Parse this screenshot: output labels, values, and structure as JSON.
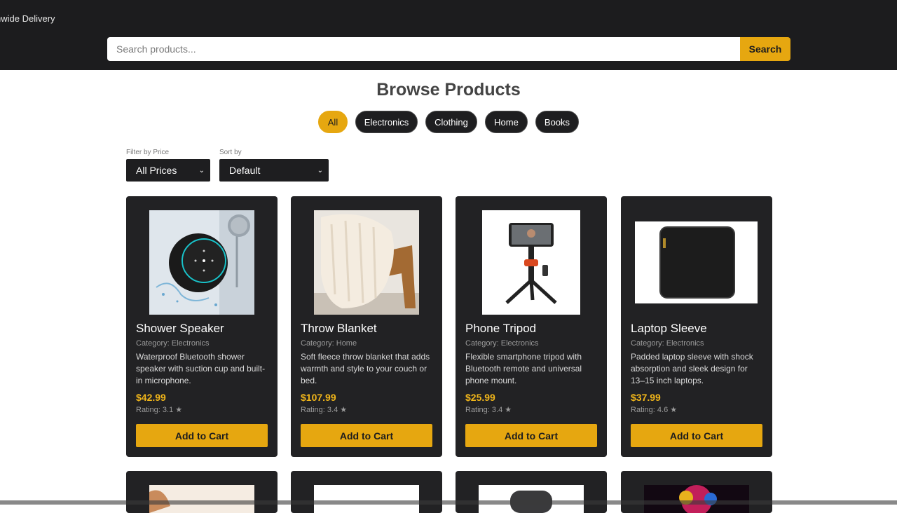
{
  "header": {
    "promo": "nwide Delivery",
    "search_placeholder": "Search products...",
    "search_label": "Search"
  },
  "page_title": "Browse Products",
  "categories": [
    "All",
    "Electronics",
    "Clothing",
    "Home",
    "Books"
  ],
  "filters": {
    "price_label": "Filter by Price",
    "price_value": "All Prices",
    "sort_label": "Sort by",
    "sort_value": "Default"
  },
  "products": [
    {
      "name": "Shower Speaker",
      "category": "Category: Electronics",
      "description": "Waterproof Bluetooth shower speaker with suction cup and built-in microphone.",
      "price": "$42.99",
      "rating": "Rating: 3.1 ★",
      "button": "Add to Cart"
    },
    {
      "name": "Throw Blanket",
      "category": "Category: Home",
      "description": "Soft fleece throw blanket that adds warmth and style to your couch or bed.",
      "price": "$107.99",
      "rating": "Rating: 3.4 ★",
      "button": "Add to Cart"
    },
    {
      "name": "Phone Tripod",
      "category": "Category: Electronics",
      "description": "Flexible smartphone tripod with Bluetooth remote and universal phone mount.",
      "price": "$25.99",
      "rating": "Rating: 3.4 ★",
      "button": "Add to Cart"
    },
    {
      "name": "Laptop Sleeve",
      "category": "Category: Electronics",
      "description": "Padded laptop sleeve with shock absorption and sleek design for 13–15 inch laptops.",
      "price": "$37.99",
      "rating": "Rating: 4.6 ★",
      "button": "Add to Cart"
    }
  ],
  "colors": {
    "accent": "#e6a710",
    "header_bg": "#1c1c1e",
    "card_bg": "#222224",
    "price": "#f0b51a"
  }
}
